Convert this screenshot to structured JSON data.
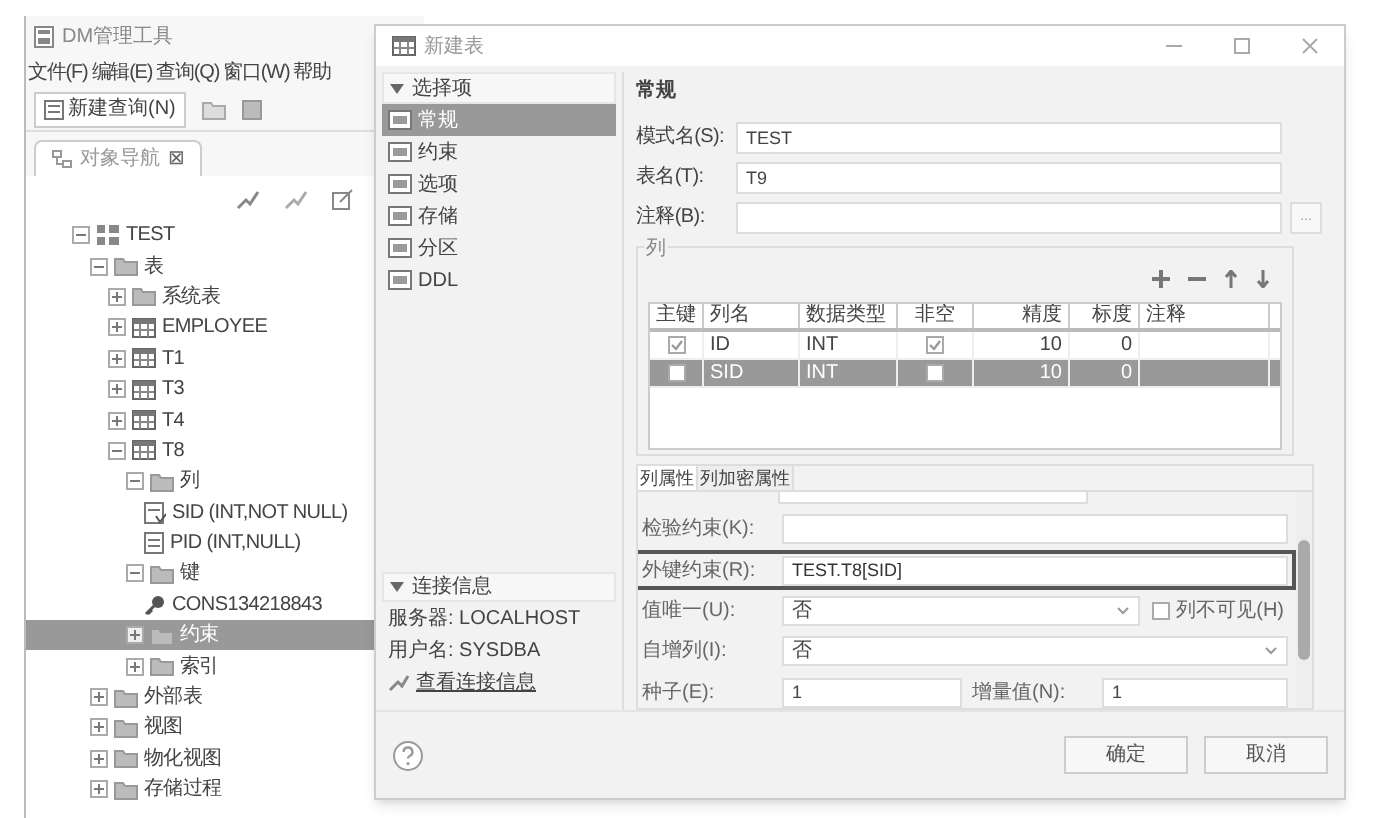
{
  "app": {
    "title": "DM管理工具",
    "menu": [
      "文件(F)",
      "编辑(E)",
      "查询(Q)",
      "窗口(W)",
      "帮助"
    ],
    "toolbar_button": "新建查询(N)",
    "panel_tab": {
      "label": "对象导航",
      "close": "⊠"
    },
    "tree": [
      {
        "label": "TEST",
        "kind": "schema",
        "expanded": true,
        "selected": false,
        "children": [
          {
            "label": "表",
            "kind": "folder",
            "expanded": true,
            "selected": false,
            "children": [
              {
                "label": "系统表",
                "kind": "folder",
                "expanded": false,
                "selected": false
              },
              {
                "label": "EMPLOYEE",
                "kind": "table",
                "expanded": false,
                "selected": false
              },
              {
                "label": "T1",
                "kind": "table",
                "expanded": false,
                "selected": false
              },
              {
                "label": "T3",
                "kind": "table",
                "expanded": false,
                "selected": false
              },
              {
                "label": "T4",
                "kind": "table",
                "expanded": false,
                "selected": false
              },
              {
                "label": "T8",
                "kind": "table",
                "expanded": true,
                "selected": false,
                "children": [
                  {
                    "label": "列",
                    "kind": "folder",
                    "expanded": true,
                    "selected": false,
                    "children": [
                      {
                        "label": "SID (INT,NOT NULL)",
                        "kind": "column_key",
                        "selected": false
                      },
                      {
                        "label": "PID (INT,NULL)",
                        "kind": "column",
                        "selected": false
                      }
                    ]
                  },
                  {
                    "label": "键",
                    "kind": "folder",
                    "expanded": true,
                    "selected": false,
                    "children": [
                      {
                        "label": "CONS134218843",
                        "kind": "key",
                        "selected": false
                      }
                    ]
                  },
                  {
                    "label": "约束",
                    "kind": "folder",
                    "expanded": false,
                    "selected": true
                  },
                  {
                    "label": "索引",
                    "kind": "folder",
                    "expanded": false,
                    "selected": false
                  }
                ]
              }
            ]
          },
          {
            "label": "外部表",
            "kind": "folder",
            "expanded": false,
            "selected": false
          },
          {
            "label": "视图",
            "kind": "folder",
            "expanded": false,
            "selected": false
          },
          {
            "label": "物化视图",
            "kind": "folder",
            "expanded": false,
            "selected": false
          },
          {
            "label": "存储过程",
            "kind": "folder",
            "expanded": false,
            "selected": false
          }
        ]
      }
    ]
  },
  "dialog": {
    "title": "新建表",
    "options_header": "选择项",
    "options": [
      {
        "label": "常规",
        "selected": true
      },
      {
        "label": "约束",
        "selected": false
      },
      {
        "label": "选项",
        "selected": false
      },
      {
        "label": "存储",
        "selected": false
      },
      {
        "label": "分区",
        "selected": false
      },
      {
        "label": "DDL",
        "selected": false
      }
    ],
    "connection": {
      "header": "连接信息",
      "server": "服务器: LOCALHOST",
      "user": "用户名: SYSDBA",
      "link": "查看连接信息"
    },
    "section_title": "常规",
    "fields": [
      {
        "label": "模式名(S):",
        "value": "TEST"
      },
      {
        "label": "表名(T):",
        "value": "T9"
      },
      {
        "label": "注释(B):",
        "browse": "..."
      }
    ],
    "columns_group": "列",
    "table": {
      "columns": [
        "主键",
        "列名",
        "数据类型",
        "非空",
        "精度",
        "标度",
        "注释"
      ],
      "rows": [
        {
          "selected": false,
          "primary_key": true,
          "name": "ID",
          "type": "INT",
          "not_null": true,
          "precision": "10",
          "scale": "0"
        },
        {
          "selected": true,
          "primary_key": false,
          "name": "SID",
          "type": "INT",
          "not_null": false,
          "precision": "10",
          "scale": "0"
        }
      ]
    },
    "prop_tabs": [
      {
        "label": "列属性",
        "selected": true
      },
      {
        "label": "列加密属性",
        "selected": false
      }
    ],
    "props": [
      {
        "kind": "text",
        "label": "检验约束(K):",
        "highlighted": false
      },
      {
        "kind": "text",
        "label": "外键约束(R):",
        "value": "TEST.T8[SID]",
        "highlighted": true
      },
      {
        "kind": "select",
        "label": "值唯一(U):",
        "value": "否",
        "checkbox": {
          "label": "列不可见(H)",
          "checked": false
        }
      },
      {
        "kind": "select",
        "label": "自增列(I):",
        "value": "否"
      },
      {
        "kind": "pair",
        "label": "种子(E):",
        "value": "1",
        "label2": "增量值(N):",
        "value2": "1"
      }
    ],
    "buttons": [
      "确定",
      "取消"
    ]
  }
}
